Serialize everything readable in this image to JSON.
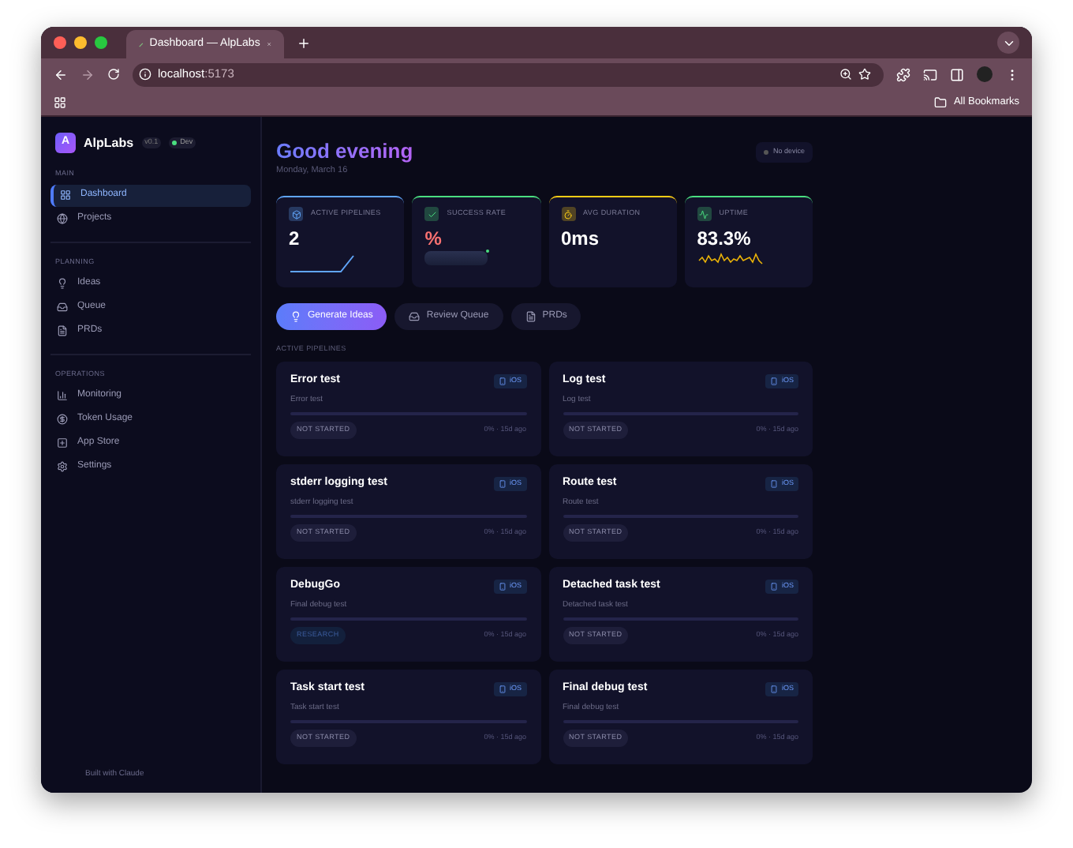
{
  "browser": {
    "tab_title": "Dashboard — AlpLabs",
    "url_host": "localhost",
    "url_port": ":5173",
    "bookmarks_label": "All Bookmarks"
  },
  "sidebar": {
    "brand_letter": "A",
    "brand": "AlpLabs",
    "version": "v0.1",
    "env": "Dev",
    "sections": [
      {
        "title": "MAIN",
        "items": [
          {
            "label": "Dashboard",
            "selected": true
          },
          {
            "label": "Projects",
            "selected": false
          }
        ]
      },
      {
        "title": "PLANNING",
        "items": [
          {
            "label": "Ideas",
            "selected": false
          },
          {
            "label": "Queue",
            "selected": false
          },
          {
            "label": "PRDs",
            "selected": false
          }
        ]
      },
      {
        "title": "OPERATIONS",
        "items": [
          {
            "label": "Monitoring",
            "selected": false
          },
          {
            "label": "Token Usage",
            "selected": false
          },
          {
            "label": "App Store",
            "selected": false
          },
          {
            "label": "Settings",
            "selected": false
          }
        ]
      }
    ],
    "footer": "Built with Claude"
  },
  "header": {
    "greeting": "Good evening",
    "date": "Monday, March 16",
    "device_status": "No device"
  },
  "stats": [
    {
      "label": "ACTIVE PIPELINES",
      "value": "2",
      "kind": "line",
      "color": "#60a5fa"
    },
    {
      "label": "SUCCESS RATE",
      "value": "%",
      "kind": "bar",
      "color": "#4ade80"
    },
    {
      "label": "AVG DURATION",
      "value": "0ms",
      "kind": "none",
      "color": "#facc15"
    },
    {
      "label": "UPTIME",
      "value": "83.3%",
      "kind": "spark",
      "color": "#4ade80"
    }
  ],
  "actions": [
    {
      "label": "Generate Ideas",
      "primary": true
    },
    {
      "label": "Review Queue",
      "primary": false
    },
    {
      "label": "PRDs",
      "primary": false
    }
  ],
  "section_title": "ACTIVE PIPELINES",
  "pipelines": [
    {
      "title": "Error test",
      "subtitle": "Error test",
      "platform": "iOS",
      "status": "NOT STARTED",
      "kind": "not_started",
      "meta": "0% · 15d ago"
    },
    {
      "title": "Log test",
      "subtitle": "Log test",
      "platform": "iOS",
      "status": "NOT STARTED",
      "kind": "not_started",
      "meta": "0% · 15d ago"
    },
    {
      "title": "stderr logging test",
      "subtitle": "stderr logging test",
      "platform": "iOS",
      "status": "NOT STARTED",
      "kind": "not_started",
      "meta": "0% · 15d ago"
    },
    {
      "title": "Route test",
      "subtitle": "Route test",
      "platform": "iOS",
      "status": "NOT STARTED",
      "kind": "not_started",
      "meta": "0% · 15d ago"
    },
    {
      "title": "DebugGo",
      "subtitle": "Final debug test",
      "platform": "iOS",
      "status": "RESEARCH",
      "kind": "research",
      "meta": "0% · 15d ago"
    },
    {
      "title": "Detached task test",
      "subtitle": "Detached task test",
      "platform": "iOS",
      "status": "NOT STARTED",
      "kind": "not_started",
      "meta": "0% · 15d ago"
    },
    {
      "title": "Task start test",
      "subtitle": "Task start test",
      "platform": "iOS",
      "status": "NOT STARTED",
      "kind": "not_started",
      "meta": "0% · 15d ago"
    },
    {
      "title": "Final debug test",
      "subtitle": "Final debug test",
      "platform": "iOS",
      "status": "NOT STARTED",
      "kind": "not_started",
      "meta": "0% · 15d ago"
    }
  ]
}
